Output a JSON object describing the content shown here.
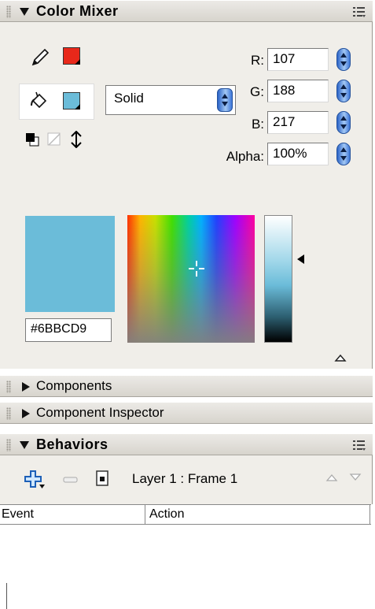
{
  "color_mixer": {
    "title": "Color Mixer",
    "stroke_color": "#e8281a",
    "fill_color": "#6bbcd9",
    "fill_type": "Solid",
    "r_label": "R:",
    "r_value": "107",
    "g_label": "G:",
    "g_value": "188",
    "b_label": "B:",
    "b_value": "217",
    "alpha_label": "Alpha:",
    "alpha_value": "100%",
    "hex_value": "#6BBCD9",
    "preview_color": "#6bbcd9"
  },
  "components": {
    "title": "Components"
  },
  "component_inspector": {
    "title": "Component Inspector"
  },
  "behaviors": {
    "title": "Behaviors",
    "target_label": "Layer 1 : Frame 1",
    "columns": [
      "Event",
      "Action"
    ]
  }
}
